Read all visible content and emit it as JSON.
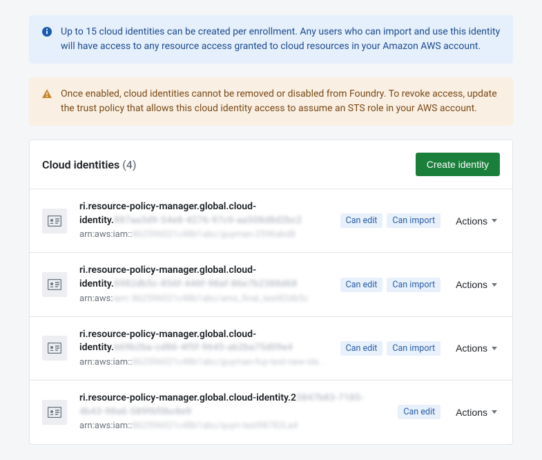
{
  "callouts": {
    "info": "Up to 15 cloud identities can be created per enrollment. Any users who can import and use this identity will have access to any resource access granted to cloud resources in your Amazon AWS account.",
    "warn": "Once enabled, cloud identities cannot be removed or disabled from Foundry. To revoke access, update the trust policy that allows this cloud identity access to assume an STS role in your AWS account."
  },
  "panel": {
    "title": "Cloud identities",
    "count": "(4)",
    "create_label": "Create identity",
    "actions_label": "Actions"
  },
  "badges": {
    "can_edit": "Can edit",
    "can_import": "Can import"
  },
  "identities": [
    {
      "title_prefix": "ri.resource-policy-manager.global.cloud-identity.",
      "title_obscured": "887aa3d9-54e8-4276-97c9-aa508d8d2bc2",
      "arn_prefix": "arn:aws:iam::",
      "arn_obscured": "862596021c48b1abc/guyman-2596abd8",
      "badges": [
        "can_edit",
        "can_import"
      ]
    },
    {
      "title_prefix": "ri.resource-policy-manager.global.cloud-identity.",
      "title_obscured": "6982db5c-856f-446f-98af-86e7b2388d68",
      "arn_prefix": "arn:aws:",
      "arn_obscured": "iam::862596021c48b1abc/amz_final_test82db5c",
      "badges": [
        "can_edit",
        "can_import"
      ]
    },
    {
      "title_prefix": "ri.resource-policy-manager.global.cloud-identity.",
      "title_obscured": "b69b2ba-cd86-4f5f-9645-ab2ba75d09e4",
      "arn_prefix": "arn:aws:iam::",
      "arn_obscured": "862596021c48b1abc/guyman-fcp-test-new-idx.  .",
      "badges": [
        "can_edit",
        "can_import"
      ]
    },
    {
      "title_prefix": "ri.resource-policy-manager.global.cloud-identity.2",
      "title_obscured": "5847b83-7185-4b43-98a6-589f6f0bc8e9",
      "arn_prefix": "arn:aws:iam::",
      "arn_obscured": "862596021c48b1abc/quyn-test98782La4",
      "badges": [
        "can_edit"
      ]
    }
  ]
}
